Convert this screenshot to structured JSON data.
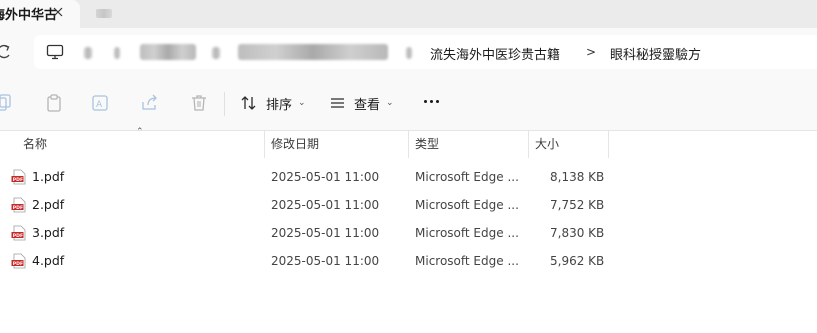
{
  "window": {
    "tab_title": "海外中华古",
    "address": {
      "crumbs": [
        "流失海外中医珍贵古籍",
        "眼科秘授靈驗方"
      ],
      "separator": ">"
    }
  },
  "toolbar": {
    "sort_label": "排序",
    "view_label": "查看",
    "icons": [
      "copy-icon",
      "paste-icon",
      "rename-icon",
      "share-icon",
      "delete-icon",
      "sort-icon",
      "view-icon",
      "more-icon"
    ]
  },
  "table": {
    "columns": [
      "名称",
      "修改日期",
      "类型",
      "大小"
    ],
    "rows": [
      {
        "name": "1.pdf",
        "modified": "2025-05-01 11:00",
        "type": "Microsoft Edge ...",
        "size": "8,138 KB"
      },
      {
        "name": "2.pdf",
        "modified": "2025-05-01 11:00",
        "type": "Microsoft Edge ...",
        "size": "7,752 KB"
      },
      {
        "name": "3.pdf",
        "modified": "2025-05-01 11:00",
        "type": "Microsoft Edge ...",
        "size": "7,830 KB"
      },
      {
        "name": "4.pdf",
        "modified": "2025-05-01 11:00",
        "type": "Microsoft Edge ...",
        "size": "5,962 KB"
      }
    ]
  },
  "colors": {
    "pdf_red": "#c62828",
    "window_bg": "#f9f9f9",
    "tab_strip": "#ebebeb"
  }
}
